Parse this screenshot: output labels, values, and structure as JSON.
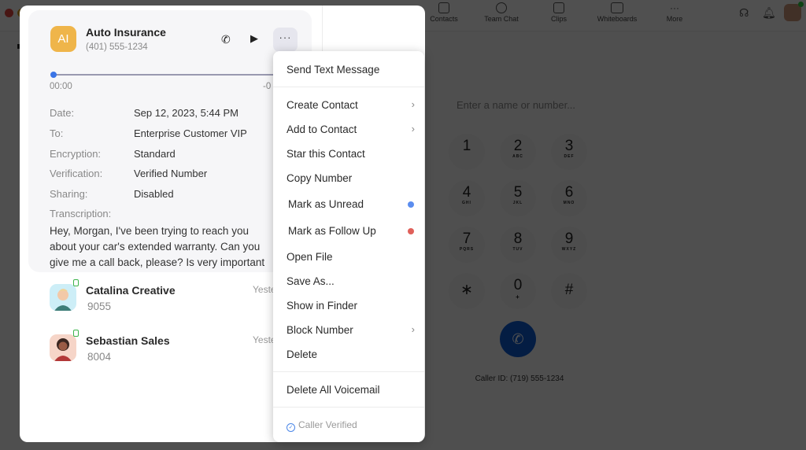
{
  "background_app": {
    "nav": [
      {
        "label": "Contacts",
        "icon": "contacts-icon"
      },
      {
        "label": "Team Chat",
        "icon": "chat-icon"
      },
      {
        "label": "Clips",
        "icon": "clips-icon"
      },
      {
        "label": "Whiteboards",
        "icon": "whiteboard-icon"
      },
      {
        "label": "More",
        "icon": "more-icon"
      }
    ],
    "more_glyph": "···",
    "dialer": {
      "placeholder": "Enter a name or number...",
      "keys": [
        {
          "digit": "1",
          "letters": ""
        },
        {
          "digit": "2",
          "letters": "ABC"
        },
        {
          "digit": "3",
          "letters": "DEF"
        },
        {
          "digit": "4",
          "letters": "GHI"
        },
        {
          "digit": "5",
          "letters": "JKL"
        },
        {
          "digit": "6",
          "letters": "MNO"
        },
        {
          "digit": "7",
          "letters": "PQRS"
        },
        {
          "digit": "8",
          "letters": "TUV"
        },
        {
          "digit": "9",
          "letters": "WXYZ"
        },
        {
          "digit": "∗",
          "letters": ""
        },
        {
          "digit": "0",
          "letters": "+"
        },
        {
          "digit": "#",
          "letters": ""
        }
      ],
      "call_glyph": "✆",
      "caller_id": "Caller ID: (719) 555-1234"
    }
  },
  "voicemail": {
    "avatar_initials": "AI",
    "avatar_color": "#efb54a",
    "name": "Auto Insurance",
    "number": "(401) 555-1234",
    "call_glyph": "✆",
    "play_glyph": "▶",
    "more_glyph": "···",
    "progress": 0,
    "time_start": "00:00",
    "time_end": "-0",
    "details": [
      {
        "label": "Date:",
        "value": "Sep 12, 2023, 5:44 PM"
      },
      {
        "label": "To:",
        "value": "Enterprise Customer VIP"
      },
      {
        "label": "Encryption:",
        "value": "Standard"
      },
      {
        "label": "Verification:",
        "value": "Verified Number"
      },
      {
        "label": "Sharing:",
        "value": "Disabled"
      }
    ],
    "transcription_label": "Transcription:",
    "transcription_lines": [
      "Hey, Morgan, I've been trying to reach you",
      "about your car's extended warranty. Can you",
      "give me a call back, please? Is very important"
    ]
  },
  "list": [
    {
      "name": "Catalina Creative",
      "ext": "9055",
      "time": "Yesterday"
    },
    {
      "name": "Sebastian Sales",
      "ext": "8004",
      "time": "Yesterday"
    }
  ],
  "menu": {
    "chevron": "›",
    "items": [
      {
        "label": "Send Text Message"
      },
      {
        "label": "Create Contact"
      },
      {
        "label": "Add to Contact"
      },
      {
        "label": "Star this Contact"
      },
      {
        "label": "Copy Number"
      },
      {
        "label": "Mark as Unread",
        "dot_color": "#5b8def"
      },
      {
        "label": "Mark as Follow Up",
        "dot_color": "#e0605a"
      },
      {
        "label": "Open File"
      },
      {
        "label": "Save As..."
      },
      {
        "label": "Show in Finder"
      },
      {
        "label": "Block Number"
      },
      {
        "label": "Delete"
      },
      {
        "label": "Delete All Voicemail"
      }
    ],
    "footer_check": "✓",
    "footer": "Caller Verified"
  }
}
